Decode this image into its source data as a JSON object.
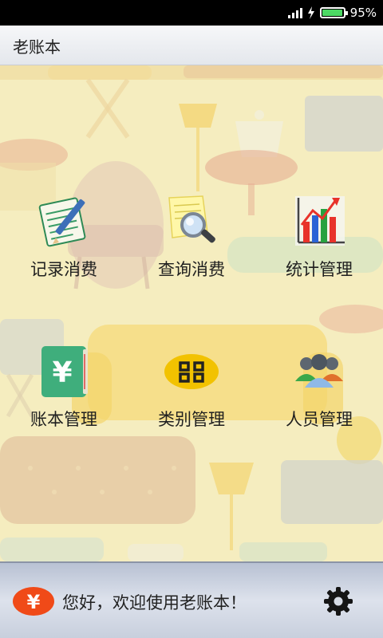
{
  "status_bar": {
    "battery_text": "95%",
    "battery_level": 0.95,
    "icons": [
      "signal-icon",
      "charging-icon",
      "battery-icon"
    ]
  },
  "app": {
    "title": "老账本"
  },
  "menu": [
    {
      "label": "记录消费",
      "icon": "notepad-pencil-icon"
    },
    {
      "label": "查询消费",
      "icon": "magnifier-note-icon"
    },
    {
      "label": "统计管理",
      "icon": "bar-chart-icon"
    },
    {
      "label": "账本管理",
      "icon": "ledger-book-icon"
    },
    {
      "label": "类别管理",
      "icon": "category-grid-icon"
    },
    {
      "label": "人员管理",
      "icon": "people-group-icon"
    }
  ],
  "footer": {
    "badge_symbol": "¥",
    "greeting": "您好，欢迎使用老账本！",
    "settings_icon": "gear-icon"
  },
  "colors": {
    "background": "#f6eec0",
    "footer_accent": "#f04a18",
    "chart_red": "#e8322a",
    "chart_green": "#27a23f",
    "chart_blue": "#2a63d6",
    "ledger_green": "#3fae7c",
    "category_yellow": "#f2c200"
  }
}
